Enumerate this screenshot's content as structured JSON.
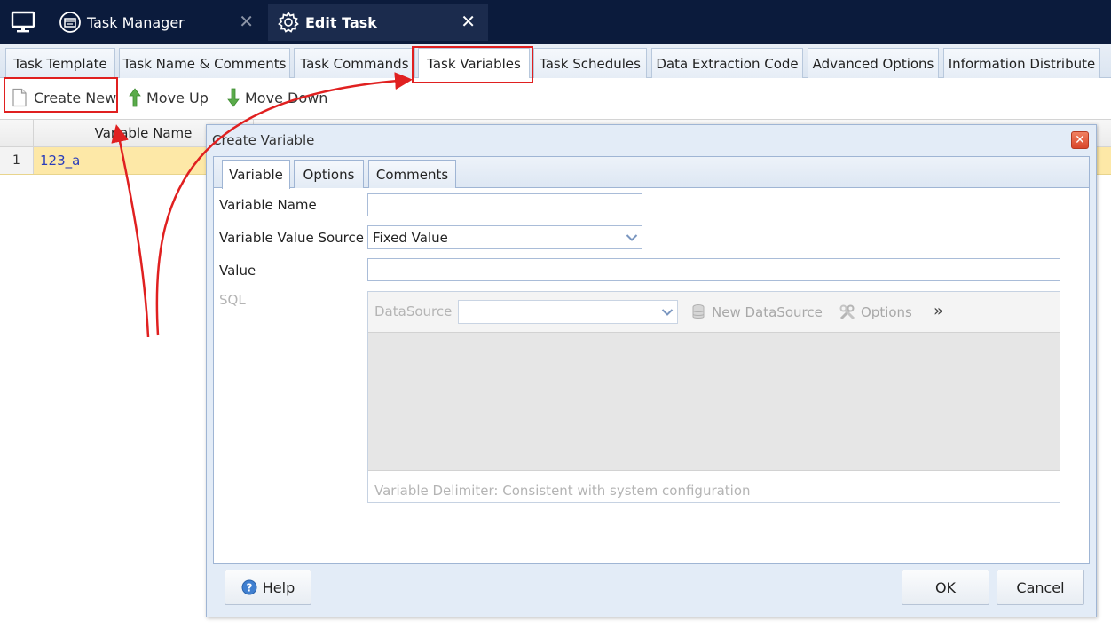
{
  "window_tabs": [
    {
      "label": "Task Manager"
    },
    {
      "label": "Edit Task"
    }
  ],
  "page_tabs": [
    {
      "label": "Task Template"
    },
    {
      "label": "Task Name & Comments"
    },
    {
      "label": "Task Commands"
    },
    {
      "label": "Task Variables"
    },
    {
      "label": "Task Schedules"
    },
    {
      "label": "Data Extraction Code"
    },
    {
      "label": "Advanced Options"
    },
    {
      "label": "Information Distribute"
    }
  ],
  "active_page_tab": "Task Variables",
  "toolbar": {
    "create_new": "Create New",
    "move_up": "Move Up",
    "move_down": "Move Down"
  },
  "grid": {
    "column_header": "Variable Name",
    "rows": [
      {
        "row_number": "1",
        "variable_name": "123_a"
      }
    ]
  },
  "dialog": {
    "title": "Create Variable",
    "tabs": [
      {
        "label": "Variable"
      },
      {
        "label": "Options"
      },
      {
        "label": "Comments"
      }
    ],
    "active_tab": "Variable",
    "fields": {
      "variable_name_label": "Variable Name",
      "variable_name_value": "",
      "value_source_label": "Variable Value Source",
      "value_source_value": "Fixed Value",
      "value_label": "Value",
      "value_value": "",
      "sql_label": "SQL"
    },
    "sql": {
      "datasource_label": "DataSource",
      "datasource_value": "",
      "new_datasource": "New DataSource",
      "options": "Options",
      "more": "»",
      "delimiter_note": "Variable Delimiter: Consistent with system configuration"
    },
    "buttons": {
      "help": "Help",
      "ok": "OK",
      "cancel": "Cancel"
    }
  },
  "colors": {
    "title_bar": "#0b1b3c",
    "selected_row": "#fde8a7",
    "annotation_red": "#e02020",
    "dialog_border": "#9fb5d4"
  },
  "icons": {
    "app": "monitor-icon",
    "task_manager": "task-manager-icon",
    "edit_task": "gear-icon",
    "create_new": "new-document-icon",
    "move_up": "arrow-up-icon",
    "move_down": "arrow-down-icon",
    "help": "help-icon",
    "close": "close-icon"
  }
}
